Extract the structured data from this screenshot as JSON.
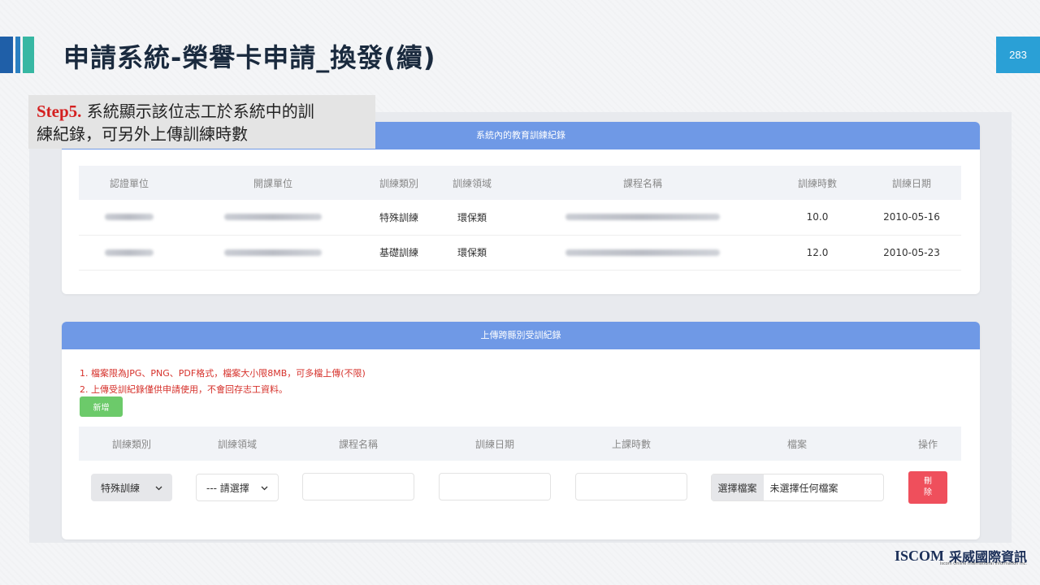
{
  "slide": {
    "title": "申請系統-榮譽卡申請_換發(續)",
    "page_number": "283",
    "step_label": "Step5.",
    "step_text_line1": " 系統顯示該位志工於系統中的訓",
    "step_text_line2": "練紀錄，可另外上傳訓練時數",
    "logo_text": "ISCOM",
    "logo_cn": "采威國際資訊",
    "logo_sub": "Iscom Online International Information Inc."
  },
  "records": {
    "header": "系統內的教育訓練紀錄",
    "columns": [
      "認證單位",
      "開課單位",
      "訓練類別",
      "訓練領域",
      "課程名稱",
      "訓練時數",
      "訓練日期"
    ],
    "rows": [
      {
        "category": "特殊訓練",
        "field": "環保類",
        "hours": "10.0",
        "date": "2010-05-16"
      },
      {
        "category": "基礎訓練",
        "field": "環保類",
        "hours": "12.0",
        "date": "2010-05-23"
      }
    ]
  },
  "upload": {
    "header": "上傳跨縣別受訓紀錄",
    "note1": "1. 檔案限為JPG、PNG、PDF格式，檔案大小限8MB，可多檔上傳(不限)",
    "note2": "2. 上傳受訓紀錄僅供申請使用，不會回存志工資料。",
    "add_label": "新增",
    "columns": [
      "訓練類別",
      "訓練領域",
      "課程名稱",
      "訓練日期",
      "上課時數",
      "檔案",
      "操作"
    ],
    "row": {
      "category": "特殊訓練",
      "field": "--- 請選擇",
      "file_button": "選擇檔案",
      "file_status": "未選擇任何檔案",
      "delete_line1": "刪",
      "delete_line2": "除"
    }
  }
}
